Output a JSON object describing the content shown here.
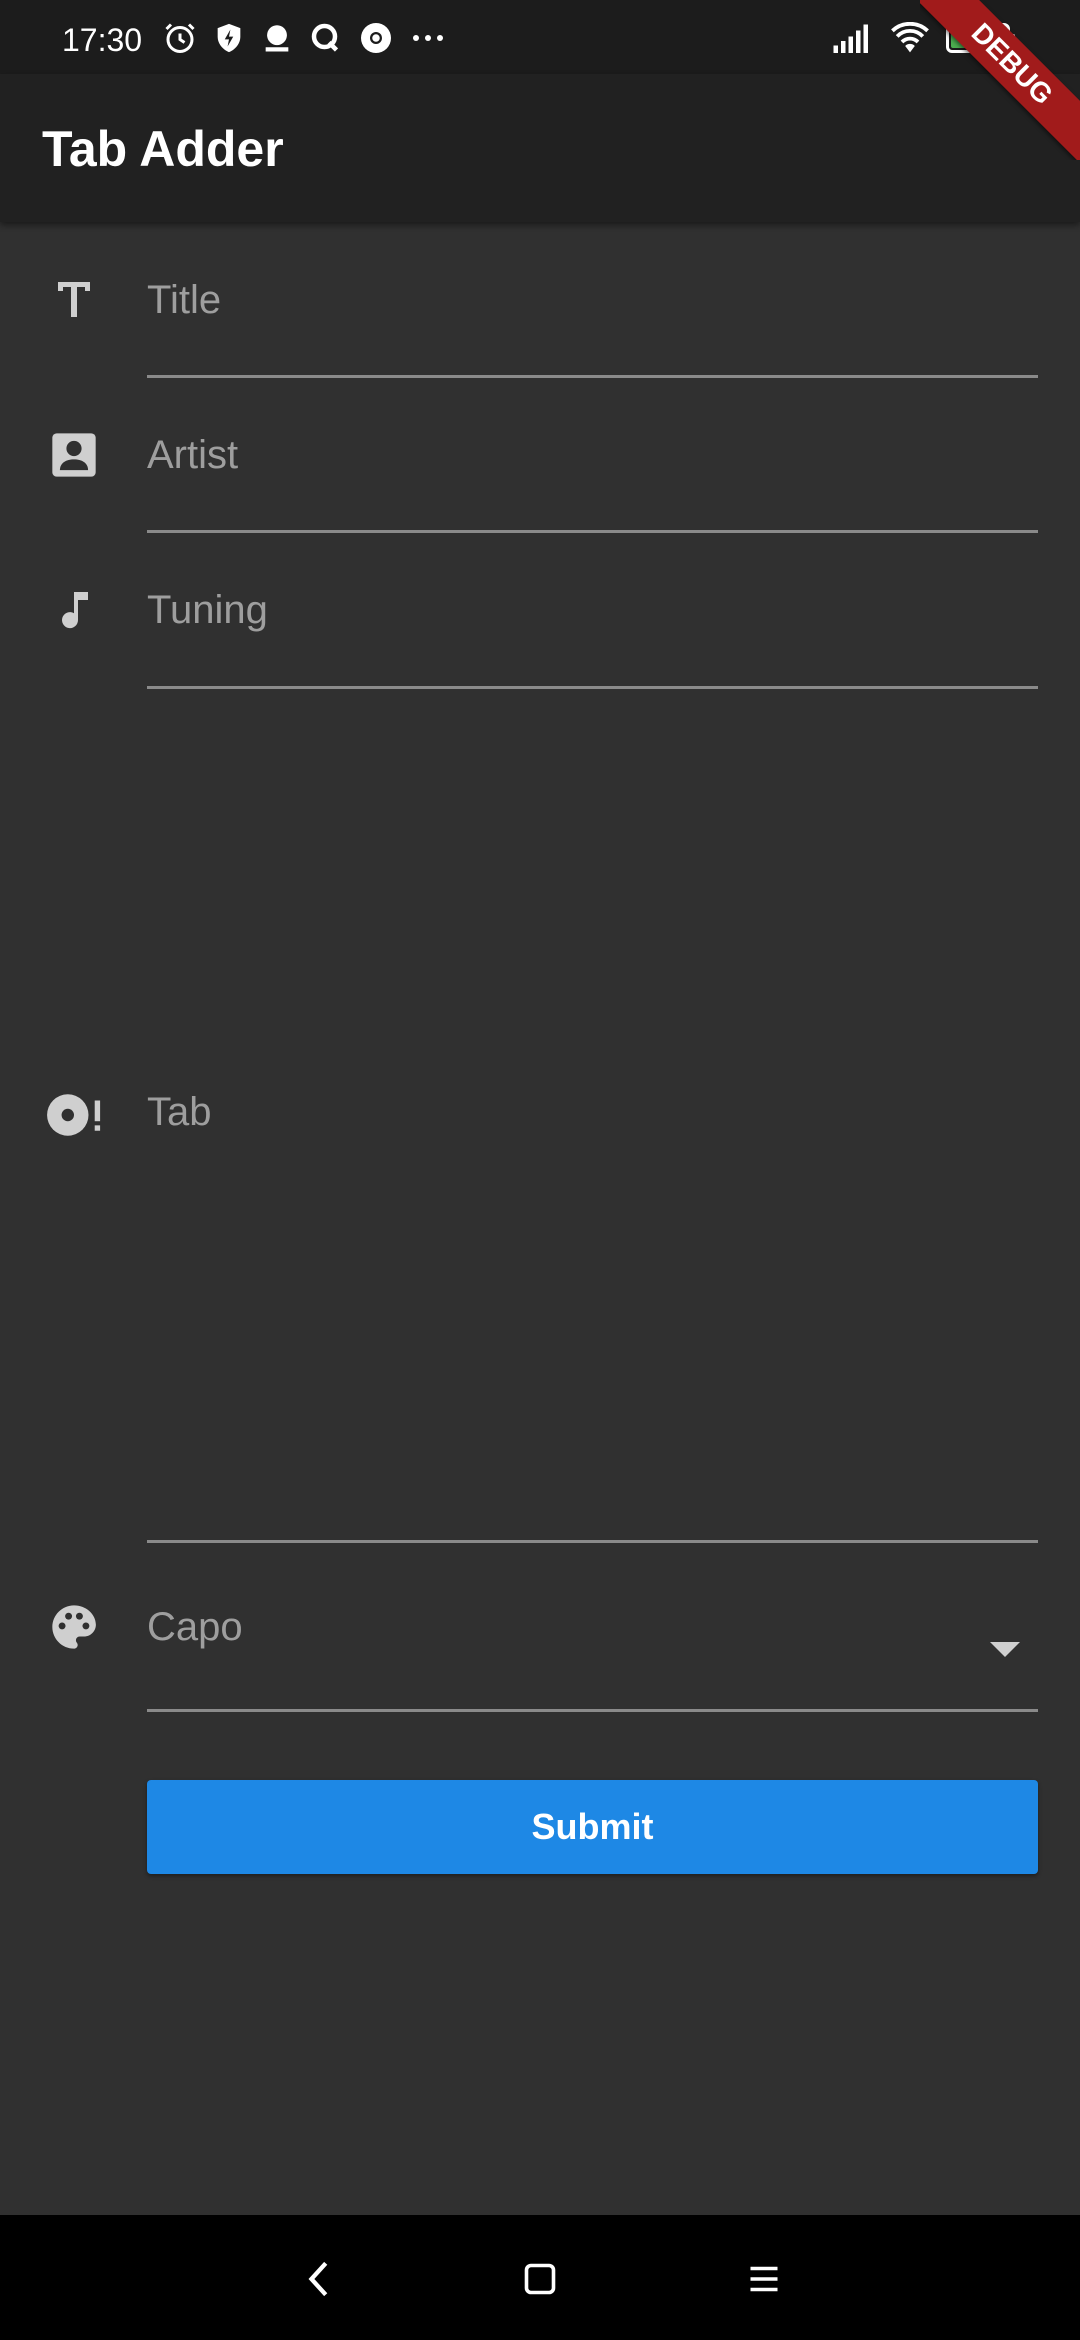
{
  "status_bar": {
    "time": "17:30",
    "left_icons": [
      "alarm-icon",
      "shield-icon",
      "notification-icon",
      "q-app-icon",
      "chrome-icon",
      "more-dots-icon"
    ],
    "right_icons": [
      "signal-icon",
      "wifi-icon",
      "battery-icon"
    ],
    "battery_level": "55"
  },
  "debug_banner": "DEBUG",
  "app_bar": {
    "title": "Tab Adder"
  },
  "form": {
    "title": {
      "placeholder": "Title",
      "value": "",
      "icon": "title-text-icon"
    },
    "artist": {
      "placeholder": "Artist",
      "value": "",
      "icon": "contact-card-icon"
    },
    "tuning": {
      "placeholder": "Tuning",
      "value": "",
      "icon": "music-note-icon"
    },
    "tab": {
      "placeholder": "Tab",
      "value": "",
      "icon": "disc-alert-icon"
    },
    "capo": {
      "placeholder": "Capo",
      "icon": "palette-icon"
    },
    "submit_label": "Submit"
  },
  "nav_bar": {
    "buttons": [
      "back-icon",
      "home-icon",
      "menu-icon"
    ]
  },
  "colors": {
    "background": "#303030",
    "app_bar": "#212121",
    "accent": "#1e88e5",
    "debug": "#a11b1b"
  }
}
